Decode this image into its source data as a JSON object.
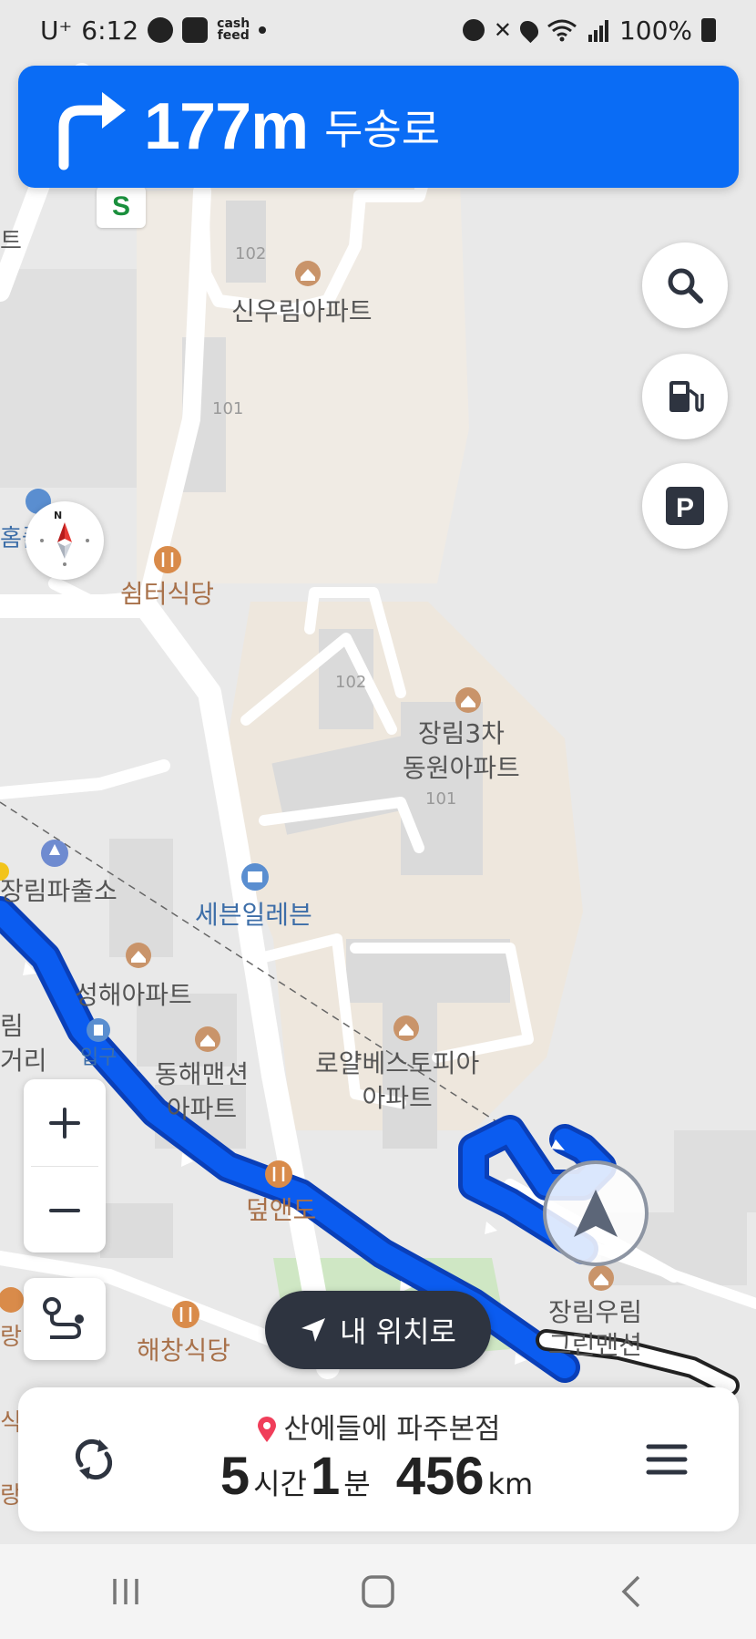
{
  "status_bar": {
    "carrier": "U⁺",
    "time": "6:12",
    "small_app_label": "cash feed",
    "battery": "100%",
    "icons": [
      "car-app-icon",
      "gallery-icon",
      "cashfeed-icon",
      "alarm-icon",
      "mute-icon",
      "location-icon",
      "wifi-icon",
      "signal-icon",
      "battery-icon"
    ]
  },
  "guidance": {
    "turn_icon": "turn-right-arrow-icon",
    "distance": "177m",
    "road": "두송로"
  },
  "map_labels": {
    "bld_102a": "102",
    "shinwoorim": "신우림아파트",
    "bld_101a": "101",
    "home_partial": "홈플",
    "shelter_restaurant": "쉼터식당",
    "bld_102b": "102",
    "jangrim3_line1": "장림3차",
    "jangrim3_line2": "동원아파트",
    "bld_101b": "101",
    "police": "장림파출소",
    "seven_eleven": "세븐일레븐",
    "seonghae": "성해아파트",
    "left_partial1": "림",
    "left_partial2": "거리",
    "entrance": "입구",
    "donghae_line1": "동해맨션",
    "donghae_line2": "아파트",
    "royal_line1": "로얄베스토피아",
    "royal_line2": "아파트",
    "deopendo": "덮앤도",
    "haechang": "해창식당",
    "jangrim_woorim_line1": "장림우림",
    "jangrim_woorim_line2": "그린맨션",
    "left_partial3": "랑",
    "left_partial4": "식",
    "left_partial5": "랑",
    "edge_t": "트"
  },
  "buttons": {
    "my_location": "내 위치로"
  },
  "destination": {
    "name": "산에들에 파주본점",
    "hours": "5",
    "hours_unit": "시간",
    "minutes": "1",
    "minutes_unit": "분",
    "distance": "456",
    "distance_unit": "km"
  },
  "colors": {
    "accent": "#0a6cf5",
    "route": "#0b5cf0",
    "route_outline": "#0a3fb8",
    "poi": "#c9946a",
    "map_bg": "#ececec",
    "road": "#ffffff",
    "block": "#f1ece5"
  }
}
